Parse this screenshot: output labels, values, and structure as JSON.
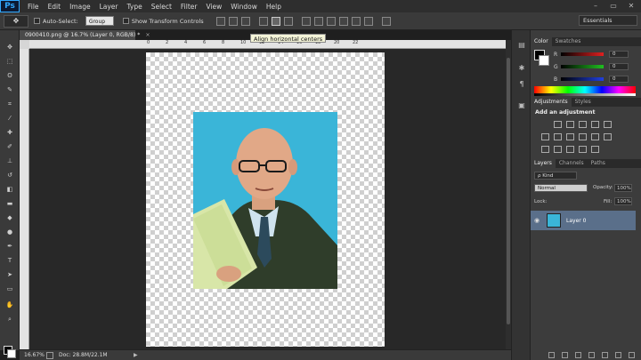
{
  "menubar": {
    "logo": "Ps",
    "items": [
      "File",
      "Edit",
      "Image",
      "Layer",
      "Type",
      "Select",
      "Filter",
      "View",
      "Window",
      "Help"
    ],
    "window_controls": [
      "–",
      "▭",
      "✕"
    ]
  },
  "options": {
    "tool_icon": "move-tool-icon",
    "auto_select_label": "Auto-Select:",
    "auto_select_value": "Group",
    "transform_label": "Show Transform Controls",
    "workspace": "Essentials"
  },
  "tooltip": {
    "text": "Align horizontal centers"
  },
  "document": {
    "tab_title": "0900410.png @ 16.7% (Layer 0, RGB/8) *",
    "tab_close": "×",
    "ruler_top_ticks": [
      "0",
      "2",
      "4",
      "6",
      "8",
      "10",
      "12",
      "14",
      "16",
      "18",
      "20",
      "22"
    ]
  },
  "status": {
    "zoom": "16.67%",
    "doc_size": "Doc: 28.8M/22.1M",
    "arrow": "▶"
  },
  "panels": {
    "color_tabs": [
      "Color",
      "Swatches"
    ],
    "color_rows": [
      {
        "label": "R",
        "value": "0",
        "color": "#e02020"
      },
      {
        "label": "G",
        "value": "0",
        "color": "#20c020"
      },
      {
        "label": "B",
        "value": "0",
        "color": "#2040e0"
      }
    ],
    "adjustments_tabs": [
      "Adjustments",
      "Styles"
    ],
    "adjustments_title": "Add an adjustment",
    "layers_tabs": [
      "Layers",
      "Channels",
      "Paths"
    ],
    "kind_label": "ρ Kind",
    "blend_mode": "Normal",
    "opacity_label": "Opacity:",
    "opacity_value": "100%",
    "lock_label": "Lock:",
    "fill_label": "Fill:",
    "fill_value": "100%",
    "layer_name": "Layer 0",
    "layer_eye": "◉"
  }
}
